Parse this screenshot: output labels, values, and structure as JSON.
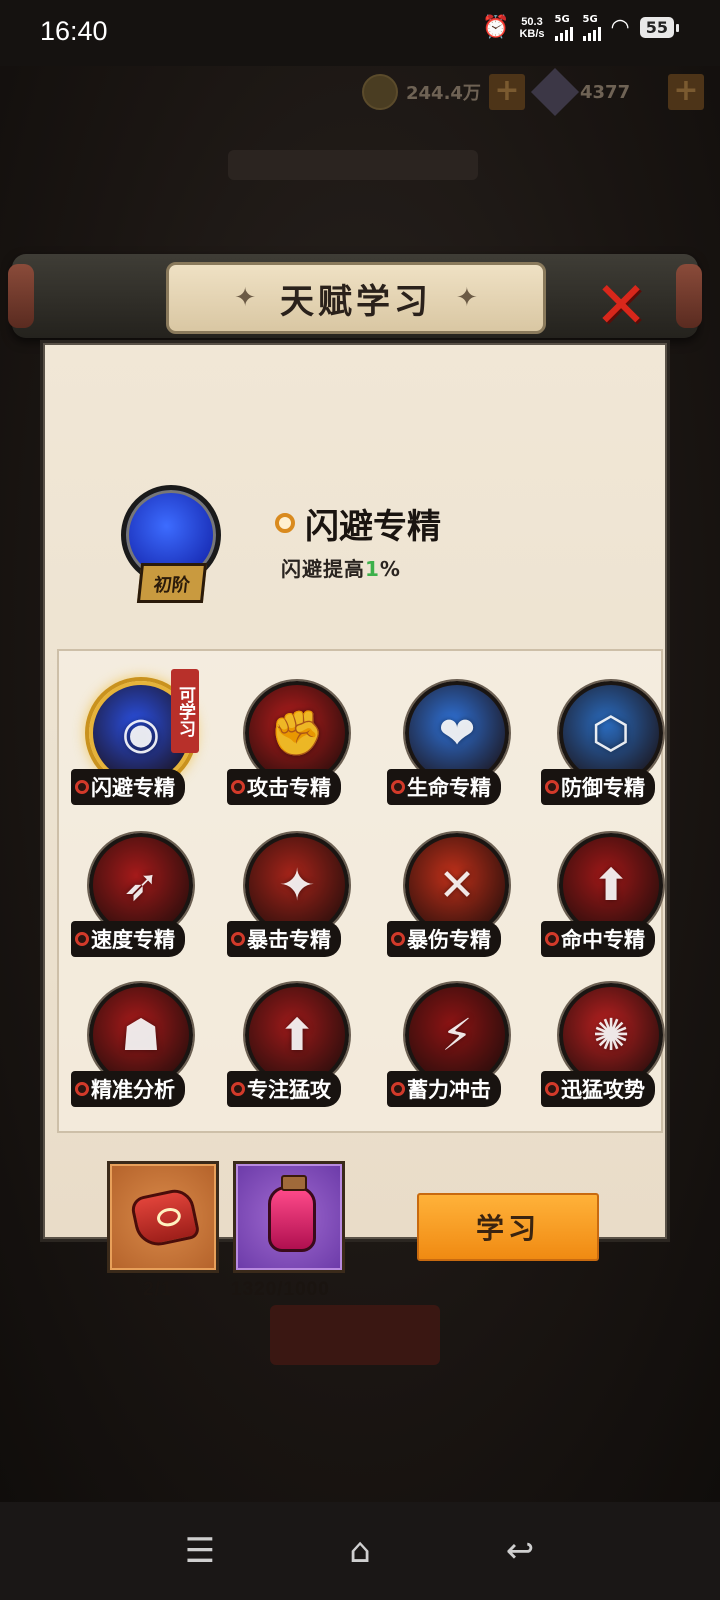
{
  "status": {
    "time": "16:40",
    "net_speed_value": "50.3",
    "net_speed_unit": "KB/s",
    "sim1": "5G",
    "sim2": "5G",
    "battery": "55"
  },
  "resources": {
    "coins": "244.4万",
    "gems": "4377",
    "plus": "+"
  },
  "dialog": {
    "title": "天赋学习",
    "title_deco": "✦",
    "close_glyph": "✕",
    "current": {
      "name": "闪避专精",
      "tier": "初阶",
      "desc_prefix": "闪避提高",
      "desc_value": "1",
      "desc_suffix": "%"
    },
    "learnable_tag": "可学习",
    "talents": [
      {
        "name": "闪避专精",
        "glyph": "◉",
        "color": "#2a4fe0",
        "selected": true
      },
      {
        "name": "攻击专精",
        "glyph": "✊",
        "color": "#b81d1d",
        "selected": false
      },
      {
        "name": "生命专精",
        "glyph": "❤",
        "color": "#2f72d8",
        "selected": false
      },
      {
        "name": "防御专精",
        "glyph": "⬡",
        "color": "#2a6cc0",
        "selected": false
      },
      {
        "name": "速度专精",
        "glyph": "➶",
        "color": "#a51a1a",
        "selected": false
      },
      {
        "name": "暴击专精",
        "glyph": "✦",
        "color": "#a8241a",
        "selected": false
      },
      {
        "name": "暴伤专精",
        "glyph": "✕",
        "color": "#c0301a",
        "selected": false
      },
      {
        "name": "命中专精",
        "glyph": "⬆",
        "color": "#a01818",
        "selected": false
      },
      {
        "name": "精准分析",
        "glyph": "☗",
        "color": "#a81a1a",
        "selected": false
      },
      {
        "name": "专注猛攻",
        "glyph": "⬆",
        "color": "#9e1a1a",
        "selected": false
      },
      {
        "name": "蓄力冲击",
        "glyph": "⚡",
        "color": "#8e1414",
        "selected": false
      },
      {
        "name": "迅猛攻势",
        "glyph": "✺",
        "color": "#b82020",
        "selected": false
      }
    ],
    "items": [
      {
        "name": "talent-stone",
        "count": "2/1"
      },
      {
        "name": "essence-jar",
        "count": "1320/1000"
      }
    ],
    "learn_button": "学习"
  },
  "navbar": {
    "menu": "☰",
    "home": "⌂",
    "back": "↩"
  }
}
